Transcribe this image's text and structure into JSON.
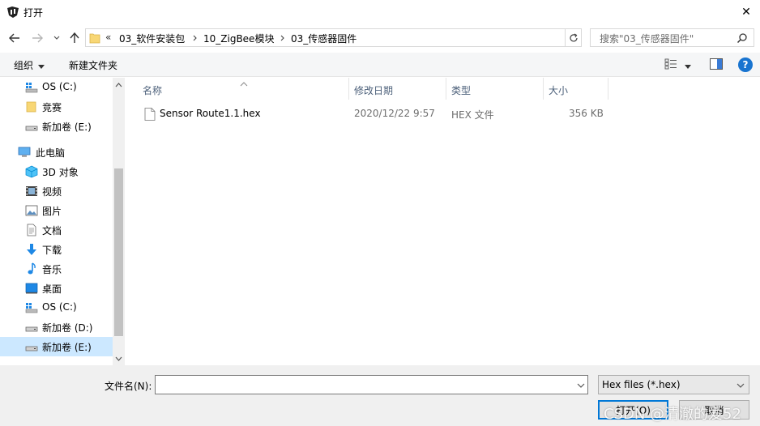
{
  "window": {
    "title": "打开",
    "close_glyph": "✕"
  },
  "address": {
    "overflow": "«",
    "crumbs": [
      "03_软件安装包",
      "10_ZigBee模块",
      "03_传感器固件"
    ]
  },
  "search": {
    "placeholder": "搜索\"03_传感器固件\""
  },
  "toolbar": {
    "organize_label": "组织",
    "new_folder_label": "新建文件夹",
    "help_label": "?"
  },
  "sidebar": {
    "items": [
      {
        "label": "OS (C:)",
        "icon": "os-drive-icon"
      },
      {
        "label": "竞赛",
        "icon": "folder-icon"
      },
      {
        "label": "新加卷 (E:)",
        "icon": "drive-icon"
      },
      {
        "label": "此电脑",
        "icon": "this-pc-icon"
      },
      {
        "label": "3D 对象",
        "icon": "3d-objects-icon"
      },
      {
        "label": "视频",
        "icon": "video-icon"
      },
      {
        "label": "图片",
        "icon": "pictures-icon"
      },
      {
        "label": "文档",
        "icon": "documents-icon"
      },
      {
        "label": "下载",
        "icon": "download-icon"
      },
      {
        "label": "音乐",
        "icon": "music-icon"
      },
      {
        "label": "桌面",
        "icon": "desktop-icon"
      },
      {
        "label": "OS (C:)",
        "icon": "os-drive-icon"
      },
      {
        "label": "新加卷 (D:)",
        "icon": "drive-icon"
      },
      {
        "label": "新加卷 (E:)",
        "icon": "drive-icon",
        "selected": true
      }
    ]
  },
  "file_list": {
    "columns": [
      "名称",
      "修改日期",
      "类型",
      "大小"
    ],
    "rows": [
      {
        "name": "Sensor Route1.1.hex",
        "modified": "2020/12/22 9:57",
        "type": "HEX 文件",
        "size": "356 KB",
        "icon": "file-icon"
      }
    ]
  },
  "bottom": {
    "filename_label": "文件名(N):",
    "filename_value": "",
    "filetype_value": "Hex files (*.hex)",
    "open_label": "打开(O)",
    "cancel_label": "取消"
  },
  "watermark": "CSDN @清澈的爱52",
  "colors": {
    "accent": "#0078d7",
    "selection": "#cce8ff",
    "toolbar_bg": "#f5f6f7",
    "bottom_bg": "#f0f0f0",
    "header_text": "#4c607a"
  }
}
